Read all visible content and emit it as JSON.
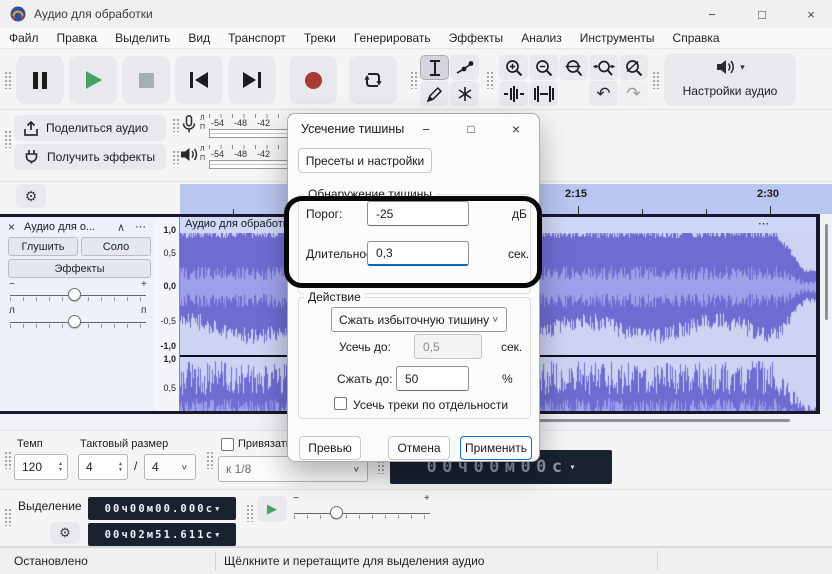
{
  "window": {
    "title": "Аудио для обработки"
  },
  "icons": {
    "minimize": "−",
    "maximize": "□",
    "close": "×",
    "collapse": "∧",
    "menu_dots": "⋯",
    "gear": "⚙",
    "undo": "↶",
    "redo": "↷",
    "play_small": "▶",
    "dropdown": "▼",
    "caret": "▾",
    "chevron": "∨",
    "spin_up": "▲",
    "spin_down": "▼",
    "minus": "−",
    "plus": "+",
    "slash": "/"
  },
  "menu": {
    "items": [
      "Файл",
      "Правка",
      "Выделить",
      "Вид",
      "Транспорт",
      "Треки",
      "Генерировать",
      "Эффекты",
      "Анализ",
      "Инструменты",
      "Справка"
    ]
  },
  "toolbar": {
    "audio_setup_label": "Настройки аудио"
  },
  "share": {
    "share_label": "Поделиться аудио",
    "effects_label": "Получить эффекты"
  },
  "meters": {
    "left": "Л",
    "right": "П",
    "scale": [
      "-54",
      "-48",
      "-42"
    ]
  },
  "timeline": {
    "labels": [
      "2:15",
      "2:30"
    ]
  },
  "track": {
    "panel_title": "Аудио для о...",
    "clip_name": "Аудио для обработки",
    "mute_label": "Глушить",
    "solo_label": "Соло",
    "effects_label": "Эффекты",
    "pan_left": "л",
    "pan_right": "п",
    "ruler_top": [
      "1,0",
      "0,5",
      "0,0",
      "-0,5",
      "-1,0"
    ],
    "ruler_bottom": [
      "1,0",
      "0,5"
    ]
  },
  "colors": {
    "accent": "#0067c0",
    "wave_bg": "#ccd3f3",
    "wave_fg": "#6e6cd1",
    "wave_rms": "#9da1ea",
    "timeline_bg": "#b9c6f0",
    "display_bg": "#1a2230",
    "play_green": "#46a165",
    "record_red": "#a93a36"
  },
  "dialog": {
    "title": "Усечение тишины",
    "presets_button": "Пресеты и настройки",
    "detection_group": "Обнаружение тишины",
    "threshold_label": "Порог:",
    "threshold_value": "-25",
    "threshold_unit": "дБ",
    "duration_label": "Длительность:",
    "duration_value": "0,3",
    "duration_unit": "сек.",
    "action_group": "Действие",
    "action_value": "Сжать избыточную тишину",
    "truncate_label": "Усечь до:",
    "truncate_value": "0,5",
    "truncate_unit": "сек.",
    "compress_label": "Сжать до:",
    "compress_value": "50",
    "compress_unit": "%",
    "independent_label": "Усечь треки по отдельности",
    "preview_button": "Превью",
    "cancel_button": "Отмена",
    "apply_button": "Применить"
  },
  "time_toolbar": {
    "tempo_label": "Темп",
    "tempo_value": "120",
    "time_sig_label": "Тактовый размер",
    "beats_value": "4",
    "denom_value": "4",
    "snap_label": "Привязать",
    "snap_value": "к 1/8",
    "time_display": "00ч00м00с"
  },
  "selection_toolbar": {
    "label": "Выделение",
    "start_value": "00ч00м00.000с",
    "end_value": "00ч02м51.611с"
  },
  "status": {
    "state": "Остановлено",
    "hint": "Щёлкните и перетащите для выделения аудио"
  }
}
